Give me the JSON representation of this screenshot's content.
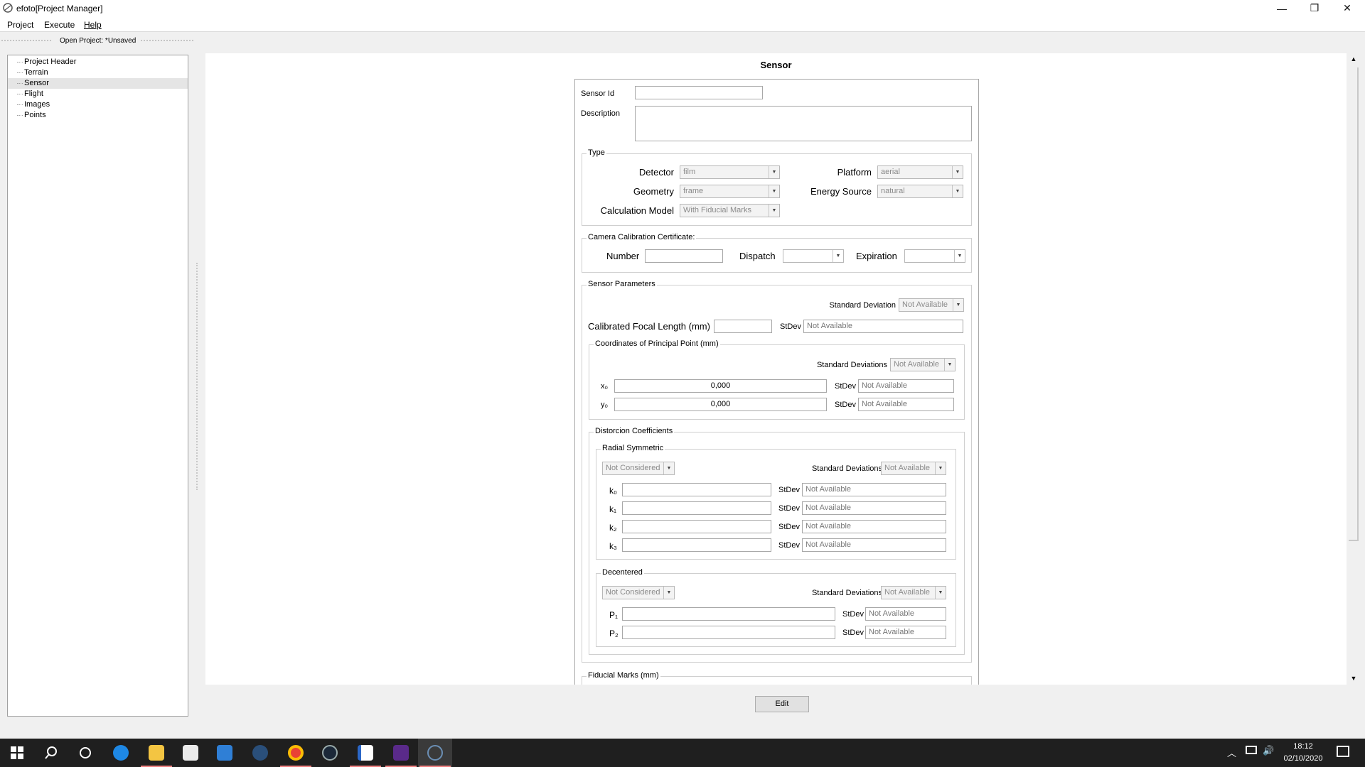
{
  "window": {
    "title": "efoto[Project Manager]",
    "minimize": "—",
    "restore": "❐",
    "close": "✕"
  },
  "menu": [
    "Project",
    "Execute",
    "Help"
  ],
  "toolbar": {
    "open_project": "Open Project: *Unsaved"
  },
  "tree": [
    {
      "label": "Project Header",
      "selected": false
    },
    {
      "label": "Terrain",
      "selected": false
    },
    {
      "label": "Sensor",
      "selected": true
    },
    {
      "label": "Flight",
      "selected": false
    },
    {
      "label": "Images",
      "selected": false
    },
    {
      "label": "Points",
      "selected": false
    }
  ],
  "sensor": {
    "title": "Sensor",
    "sensor_id_label": "Sensor Id",
    "sensor_id_value": "",
    "description_label": "Description",
    "description_value": "",
    "type": {
      "group": "Type",
      "detector_label": "Detector",
      "detector_value": "film",
      "geometry_label": "Geometry",
      "geometry_value": "frame",
      "calc_model_label": "Calculation Model",
      "calc_model_value": "With Fiducial Marks",
      "platform_label": "Platform",
      "platform_value": "aerial",
      "energy_label": "Energy Source",
      "energy_value": "natural"
    },
    "calibration": {
      "group": "Camera Calibration Certificate:",
      "number_label": "Number",
      "number_value": "",
      "dispatch_label": "Dispatch",
      "dispatch_value": "",
      "expiration_label": "Expiration",
      "expiration_value": ""
    },
    "params": {
      "group": "Sensor Parameters",
      "std_dev_label": "Standard Deviation",
      "std_dev_value": "Not Available",
      "focal_label": "Calibrated Focal Length (mm)",
      "focal_value": "",
      "stdev_label": "StDev",
      "focal_stdev": "Not Available",
      "pp_group": "Coordinates of Principal Point (mm)",
      "pp_std_label": "Standard Deviations",
      "pp_std_value": "Not Available",
      "x0_label": "x₀",
      "x0_value": "0,000",
      "x0_stdev": "Not Available",
      "y0_label": "y₀",
      "y0_value": "0,000",
      "y0_stdev": "Not Available",
      "dist_group": "Distorcion Coefficients",
      "radial_group": "Radial Symmetric",
      "radial_mode": "Not Considered",
      "radial_std_label": "Standard Deviations",
      "radial_std_value": "Not Available",
      "k": [
        {
          "label": "k₀",
          "value": "",
          "stdev": "Not Available"
        },
        {
          "label": "k₁",
          "value": "",
          "stdev": "Not Available"
        },
        {
          "label": "k₂",
          "value": "",
          "stdev": "Not Available"
        },
        {
          "label": "k₃",
          "value": "",
          "stdev": "Not Available"
        }
      ],
      "dec_group": "Decentered",
      "dec_mode": "Not Considered",
      "dec_std_label": "Standard Deviations",
      "dec_std_value": "Not Available",
      "p": [
        {
          "label": "P₁",
          "value": "",
          "stdev": "Not Available"
        },
        {
          "label": "P₂",
          "value": "",
          "stdev": "Not Available"
        }
      ]
    },
    "fiducial_group": "Fiducial Marks (mm)",
    "edit_button": "Edit"
  },
  "taskbar": {
    "clock_time": "18:12",
    "clock_date": "02/10/2020",
    "apps": [
      "windows-start-icon",
      "search-icon",
      "cortana-icon",
      "edge-icon",
      "file-explorer-icon",
      "store-icon",
      "mail-icon",
      "headset-app-icon",
      "chrome-icon",
      "steam-icon",
      "document-app-icon",
      "game-app-icon",
      "efoto-app-icon"
    ]
  },
  "colors": {
    "taskbar_bg": "#1f1f1f",
    "selection_bg": "#e5e5e5",
    "active_underline": "#f08080"
  }
}
